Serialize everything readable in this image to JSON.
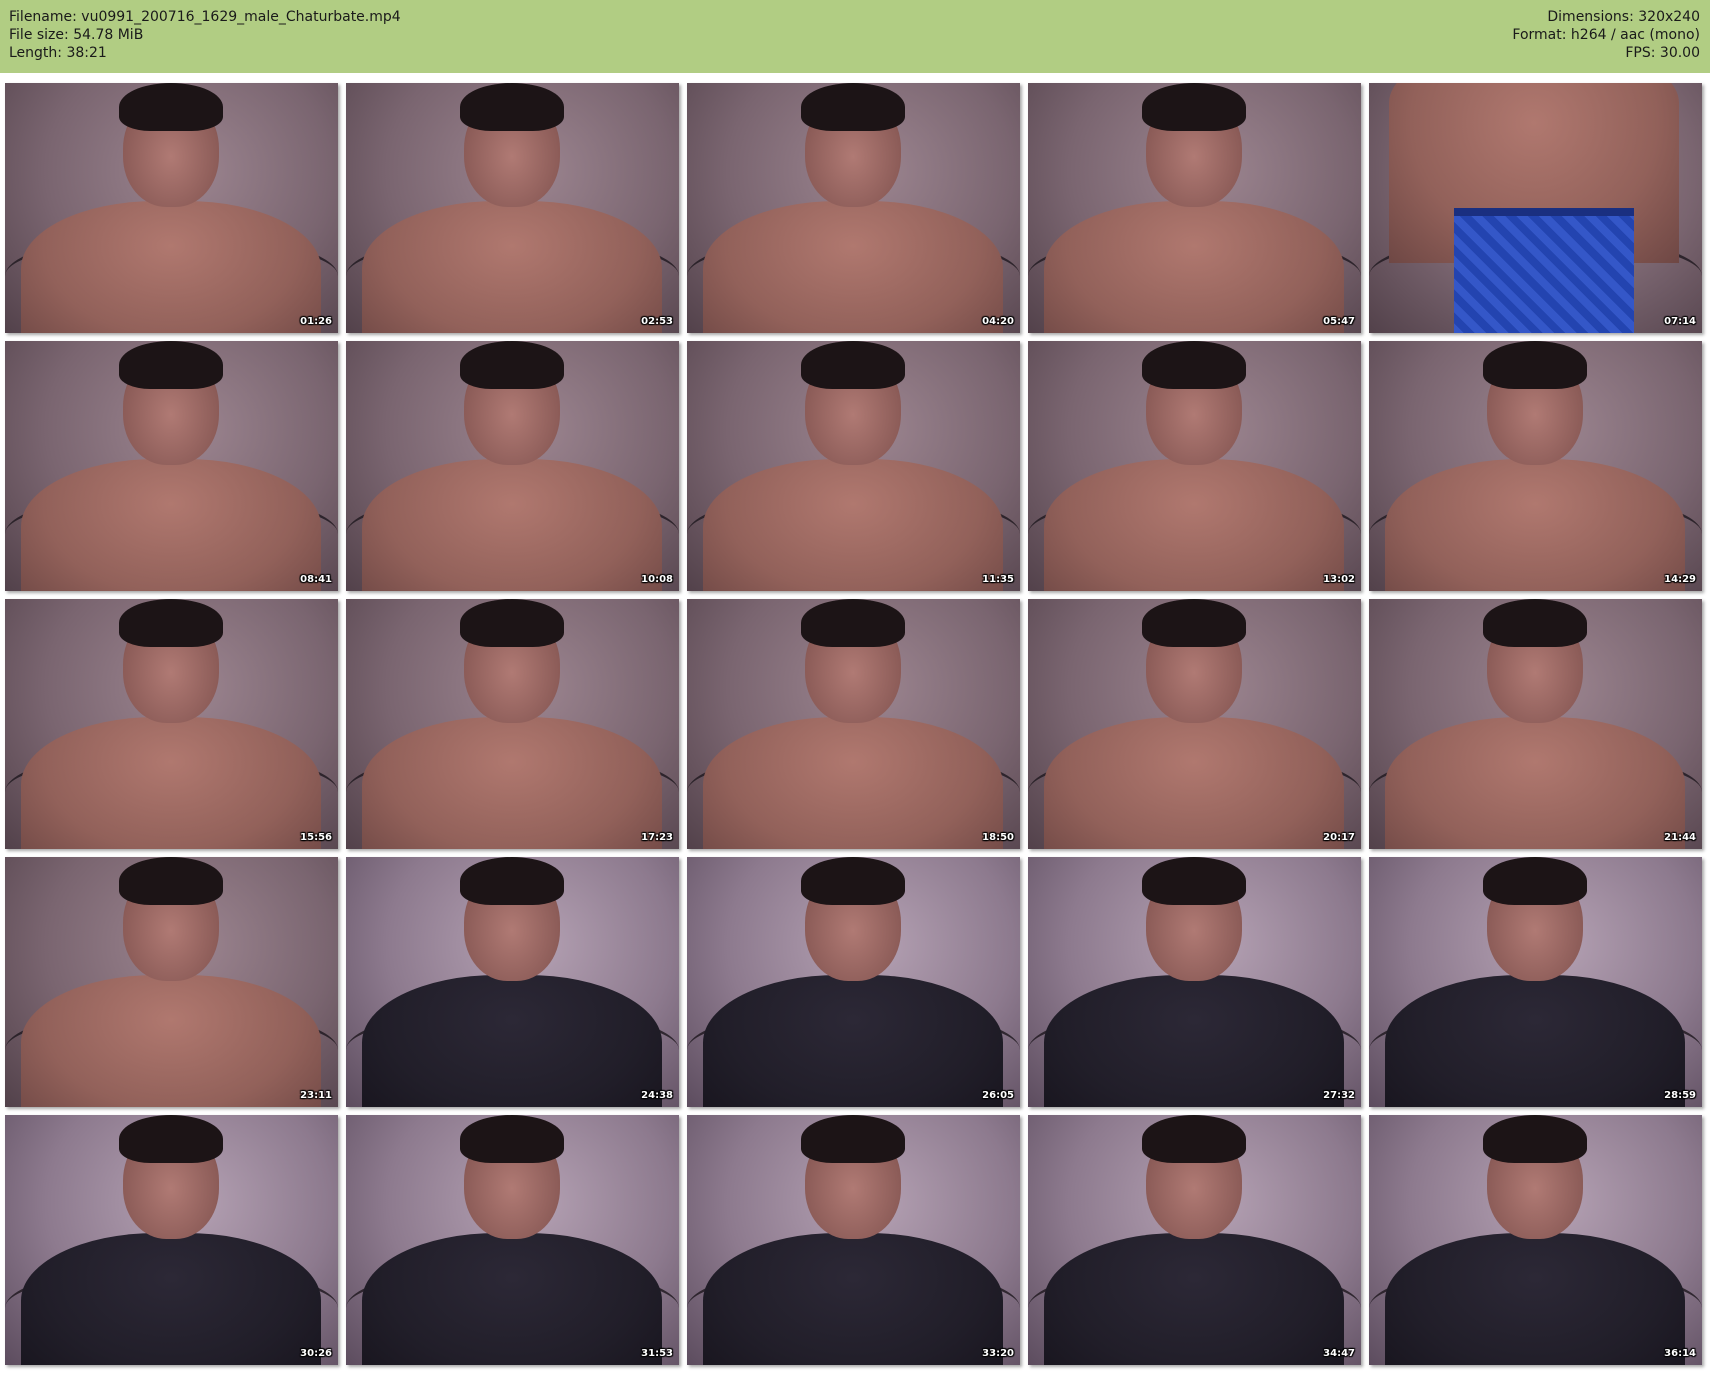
{
  "header": {
    "filename": "Filename: vu0991_200716_1629_male_Chaturbate.mp4",
    "file_size": "File size: 54.78 MiB",
    "length": "Length: 38:21",
    "dimensions": "Dimensions: 320x240",
    "format": "Format: h264 / aac (mono)",
    "fps": "FPS: 30.00",
    "background_color": "#b1cd83"
  },
  "thumbnails": [
    {
      "timestamp": "01:26",
      "scene": "shirtless"
    },
    {
      "timestamp": "02:53",
      "scene": "shirtless"
    },
    {
      "timestamp": "04:20",
      "scene": "shirtless"
    },
    {
      "timestamp": "05:47",
      "scene": "shirtless"
    },
    {
      "timestamp": "07:14",
      "scene": "boxers"
    },
    {
      "timestamp": "08:41",
      "scene": "shirtless"
    },
    {
      "timestamp": "10:08",
      "scene": "shirtless"
    },
    {
      "timestamp": "11:35",
      "scene": "shirtless"
    },
    {
      "timestamp": "13:02",
      "scene": "shirtless"
    },
    {
      "timestamp": "14:29",
      "scene": "shirtless"
    },
    {
      "timestamp": "15:56",
      "scene": "shirtless"
    },
    {
      "timestamp": "17:23",
      "scene": "shirtless"
    },
    {
      "timestamp": "18:50",
      "scene": "shirtless"
    },
    {
      "timestamp": "20:17",
      "scene": "shirtless"
    },
    {
      "timestamp": "21:44",
      "scene": "shirtless"
    },
    {
      "timestamp": "23:11",
      "scene": "shirtless"
    },
    {
      "timestamp": "24:38",
      "scene": "shirt"
    },
    {
      "timestamp": "26:05",
      "scene": "shirt"
    },
    {
      "timestamp": "27:32",
      "scene": "shirt"
    },
    {
      "timestamp": "28:59",
      "scene": "shirt"
    },
    {
      "timestamp": "30:26",
      "scene": "shirt"
    },
    {
      "timestamp": "31:53",
      "scene": "shirt"
    },
    {
      "timestamp": "33:20",
      "scene": "shirt"
    },
    {
      "timestamp": "34:47",
      "scene": "shirt"
    },
    {
      "timestamp": "36:14",
      "scene": "shirt"
    }
  ]
}
